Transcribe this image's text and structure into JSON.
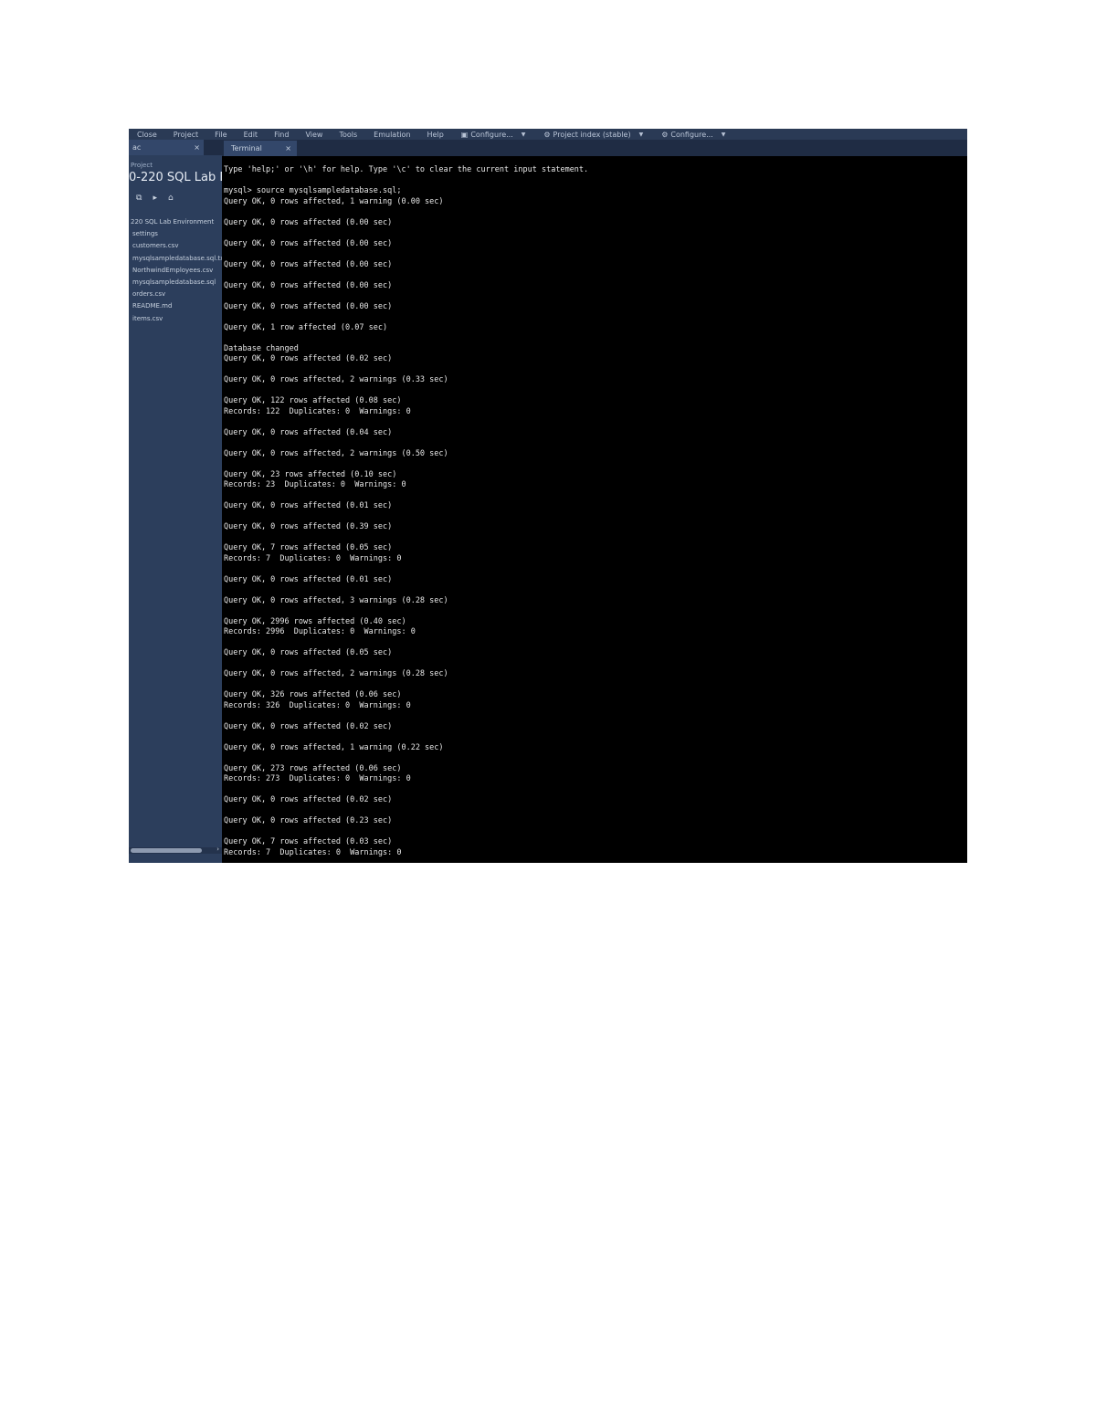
{
  "menubar": {
    "items": [
      "Close",
      "Project",
      "File",
      "Edit",
      "Find",
      "View",
      "Tools",
      "Emulation",
      "Help"
    ],
    "tools": [
      {
        "label": "Configure...",
        "icon": "window-icon"
      },
      {
        "label": "Project index (stable)",
        "icon": "gear-icon"
      },
      {
        "label": "Configure...",
        "icon": "gear-icon"
      }
    ]
  },
  "sidebar": {
    "tab_label": "ac",
    "tab_close": "×",
    "small_label": "Project",
    "title": "0-220 SQL Lab E...",
    "tools": [
      "⧉",
      "▸",
      "⌂"
    ],
    "files": [
      "220 SQL Lab Environment",
      "settings",
      "customers.csv",
      "mysqlsampledatabase.sql.txt",
      "NorthwindEmployees.csv",
      "mysqlsampledatabase.sql",
      "orders.csv",
      "README.md",
      "items.csv"
    ],
    "scroll_arrow": "›"
  },
  "main_tab": {
    "label": "Terminal",
    "close": "×"
  },
  "terminal": {
    "lines": [
      "Type 'help;' or '\\h' for help. Type '\\c' to clear the current input statement.",
      "",
      "mysql> source mysqlsampledatabase.sql;",
      "Query OK, 0 rows affected, 1 warning (0.00 sec)",
      "",
      "Query OK, 0 rows affected (0.00 sec)",
      "",
      "Query OK, 0 rows affected (0.00 sec)",
      "",
      "Query OK, 0 rows affected (0.00 sec)",
      "",
      "Query OK, 0 rows affected (0.00 sec)",
      "",
      "Query OK, 0 rows affected (0.00 sec)",
      "",
      "Query OK, 1 row affected (0.07 sec)",
      "",
      "Database changed",
      "Query OK, 0 rows affected (0.02 sec)",
      "",
      "Query OK, 0 rows affected, 2 warnings (0.33 sec)",
      "",
      "Query OK, 122 rows affected (0.08 sec)",
      "Records: 122  Duplicates: 0  Warnings: 0",
      "",
      "Query OK, 0 rows affected (0.04 sec)",
      "",
      "Query OK, 0 rows affected, 2 warnings (0.50 sec)",
      "",
      "Query OK, 23 rows affected (0.10 sec)",
      "Records: 23  Duplicates: 0  Warnings: 0",
      "",
      "Query OK, 0 rows affected (0.01 sec)",
      "",
      "Query OK, 0 rows affected (0.39 sec)",
      "",
      "Query OK, 7 rows affected (0.05 sec)",
      "Records: 7  Duplicates: 0  Warnings: 0",
      "",
      "Query OK, 0 rows affected (0.01 sec)",
      "",
      "Query OK, 0 rows affected, 3 warnings (0.28 sec)",
      "",
      "Query OK, 2996 rows affected (0.40 sec)",
      "Records: 2996  Duplicates: 0  Warnings: 0",
      "",
      "Query OK, 0 rows affected (0.05 sec)",
      "",
      "Query OK, 0 rows affected, 2 warnings (0.28 sec)",
      "",
      "Query OK, 326 rows affected (0.06 sec)",
      "Records: 326  Duplicates: 0  Warnings: 0",
      "",
      "Query OK, 0 rows affected (0.02 sec)",
      "",
      "Query OK, 0 rows affected, 1 warning (0.22 sec)",
      "",
      "Query OK, 273 rows affected (0.06 sec)",
      "Records: 273  Duplicates: 0  Warnings: 0",
      "",
      "Query OK, 0 rows affected (0.02 sec)",
      "",
      "Query OK, 0 rows affected (0.23 sec)",
      "",
      "Query OK, 7 rows affected (0.03 sec)",
      "Records: 7  Duplicates: 0  Warnings: 0"
    ]
  }
}
